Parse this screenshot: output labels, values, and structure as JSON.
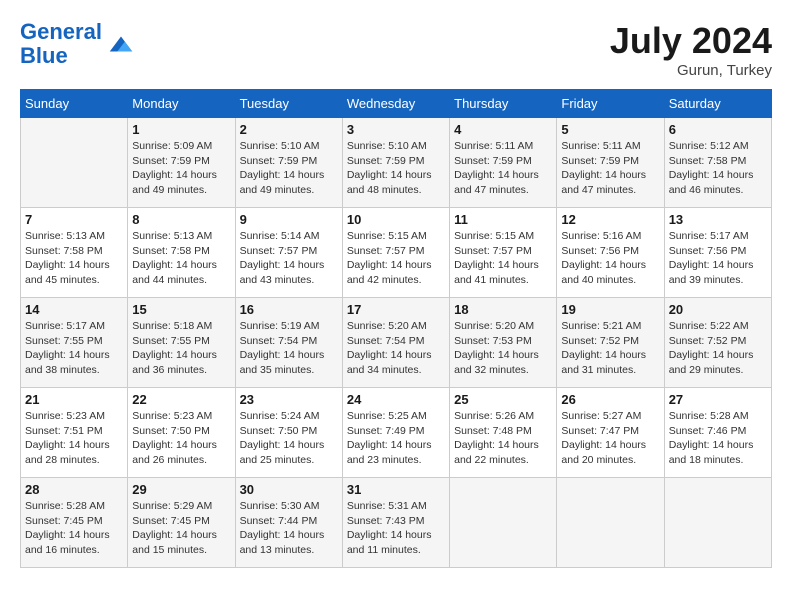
{
  "header": {
    "logo_line1": "General",
    "logo_line2": "Blue",
    "month_year": "July 2024",
    "location": "Gurun, Turkey"
  },
  "days_of_week": [
    "Sunday",
    "Monday",
    "Tuesday",
    "Wednesday",
    "Thursday",
    "Friday",
    "Saturday"
  ],
  "weeks": [
    [
      {
        "day": "",
        "info": ""
      },
      {
        "day": "1",
        "info": "Sunrise: 5:09 AM\nSunset: 7:59 PM\nDaylight: 14 hours\nand 49 minutes."
      },
      {
        "day": "2",
        "info": "Sunrise: 5:10 AM\nSunset: 7:59 PM\nDaylight: 14 hours\nand 49 minutes."
      },
      {
        "day": "3",
        "info": "Sunrise: 5:10 AM\nSunset: 7:59 PM\nDaylight: 14 hours\nand 48 minutes."
      },
      {
        "day": "4",
        "info": "Sunrise: 5:11 AM\nSunset: 7:59 PM\nDaylight: 14 hours\nand 47 minutes."
      },
      {
        "day": "5",
        "info": "Sunrise: 5:11 AM\nSunset: 7:59 PM\nDaylight: 14 hours\nand 47 minutes."
      },
      {
        "day": "6",
        "info": "Sunrise: 5:12 AM\nSunset: 7:58 PM\nDaylight: 14 hours\nand 46 minutes."
      }
    ],
    [
      {
        "day": "7",
        "info": "Sunrise: 5:13 AM\nSunset: 7:58 PM\nDaylight: 14 hours\nand 45 minutes."
      },
      {
        "day": "8",
        "info": "Sunrise: 5:13 AM\nSunset: 7:58 PM\nDaylight: 14 hours\nand 44 minutes."
      },
      {
        "day": "9",
        "info": "Sunrise: 5:14 AM\nSunset: 7:57 PM\nDaylight: 14 hours\nand 43 minutes."
      },
      {
        "day": "10",
        "info": "Sunrise: 5:15 AM\nSunset: 7:57 PM\nDaylight: 14 hours\nand 42 minutes."
      },
      {
        "day": "11",
        "info": "Sunrise: 5:15 AM\nSunset: 7:57 PM\nDaylight: 14 hours\nand 41 minutes."
      },
      {
        "day": "12",
        "info": "Sunrise: 5:16 AM\nSunset: 7:56 PM\nDaylight: 14 hours\nand 40 minutes."
      },
      {
        "day": "13",
        "info": "Sunrise: 5:17 AM\nSunset: 7:56 PM\nDaylight: 14 hours\nand 39 minutes."
      }
    ],
    [
      {
        "day": "14",
        "info": "Sunrise: 5:17 AM\nSunset: 7:55 PM\nDaylight: 14 hours\nand 38 minutes."
      },
      {
        "day": "15",
        "info": "Sunrise: 5:18 AM\nSunset: 7:55 PM\nDaylight: 14 hours\nand 36 minutes."
      },
      {
        "day": "16",
        "info": "Sunrise: 5:19 AM\nSunset: 7:54 PM\nDaylight: 14 hours\nand 35 minutes."
      },
      {
        "day": "17",
        "info": "Sunrise: 5:20 AM\nSunset: 7:54 PM\nDaylight: 14 hours\nand 34 minutes."
      },
      {
        "day": "18",
        "info": "Sunrise: 5:20 AM\nSunset: 7:53 PM\nDaylight: 14 hours\nand 32 minutes."
      },
      {
        "day": "19",
        "info": "Sunrise: 5:21 AM\nSunset: 7:52 PM\nDaylight: 14 hours\nand 31 minutes."
      },
      {
        "day": "20",
        "info": "Sunrise: 5:22 AM\nSunset: 7:52 PM\nDaylight: 14 hours\nand 29 minutes."
      }
    ],
    [
      {
        "day": "21",
        "info": "Sunrise: 5:23 AM\nSunset: 7:51 PM\nDaylight: 14 hours\nand 28 minutes."
      },
      {
        "day": "22",
        "info": "Sunrise: 5:23 AM\nSunset: 7:50 PM\nDaylight: 14 hours\nand 26 minutes."
      },
      {
        "day": "23",
        "info": "Sunrise: 5:24 AM\nSunset: 7:50 PM\nDaylight: 14 hours\nand 25 minutes."
      },
      {
        "day": "24",
        "info": "Sunrise: 5:25 AM\nSunset: 7:49 PM\nDaylight: 14 hours\nand 23 minutes."
      },
      {
        "day": "25",
        "info": "Sunrise: 5:26 AM\nSunset: 7:48 PM\nDaylight: 14 hours\nand 22 minutes."
      },
      {
        "day": "26",
        "info": "Sunrise: 5:27 AM\nSunset: 7:47 PM\nDaylight: 14 hours\nand 20 minutes."
      },
      {
        "day": "27",
        "info": "Sunrise: 5:28 AM\nSunset: 7:46 PM\nDaylight: 14 hours\nand 18 minutes."
      }
    ],
    [
      {
        "day": "28",
        "info": "Sunrise: 5:28 AM\nSunset: 7:45 PM\nDaylight: 14 hours\nand 16 minutes."
      },
      {
        "day": "29",
        "info": "Sunrise: 5:29 AM\nSunset: 7:45 PM\nDaylight: 14 hours\nand 15 minutes."
      },
      {
        "day": "30",
        "info": "Sunrise: 5:30 AM\nSunset: 7:44 PM\nDaylight: 14 hours\nand 13 minutes."
      },
      {
        "day": "31",
        "info": "Sunrise: 5:31 AM\nSunset: 7:43 PM\nDaylight: 14 hours\nand 11 minutes."
      },
      {
        "day": "",
        "info": ""
      },
      {
        "day": "",
        "info": ""
      },
      {
        "day": "",
        "info": ""
      }
    ]
  ]
}
